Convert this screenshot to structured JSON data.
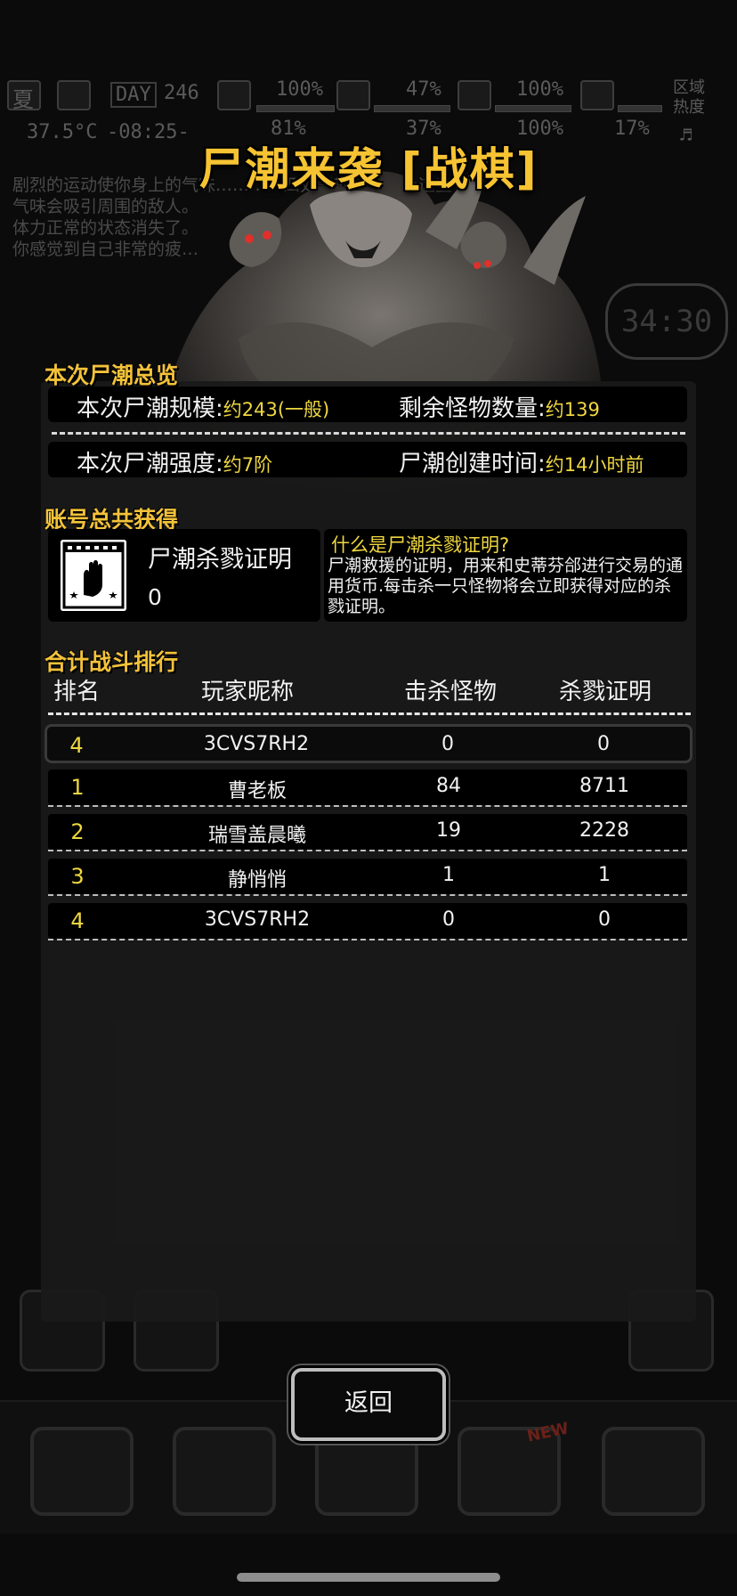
{
  "hud": {
    "season": "夏",
    "day_label": "DAY",
    "day_value": "246",
    "temperature": "37.5°C",
    "clock": "-08:25-",
    "health_pct": "100%",
    "stomach_pct": "47%",
    "stat3_pct": "100%",
    "row2_pct1": "81%",
    "row2_pct2": "37%",
    "row2_pct3": "100%",
    "row2_pct4": "17%",
    "region_heat_label": "区域热度",
    "messages": [
      "剧烈的运动使你身上的气味…………四处飘散，小心！这些",
      "气味会吸引周围的敌人。",
      "体力正常的状态消失了。",
      "你感觉到自己非常的疲…"
    ],
    "timer": "34:30",
    "new_badge": "NEW"
  },
  "title": "尸潮来袭 [战棋]",
  "overview": {
    "heading": "本次尸潮总览",
    "scale_label": "本次尸潮规模:",
    "scale_value": "约243(一般)",
    "remaining_label": "剩余怪物数量:",
    "remaining_value": "约139",
    "intensity_label": "本次尸潮强度:",
    "intensity_value": "约7阶",
    "created_label": "尸潮创建时间:",
    "created_value": "约14小时前"
  },
  "account": {
    "heading": "账号总共获得",
    "cert_name": "尸潮杀戮证明",
    "cert_count": "0",
    "what_title": "什么是尸潮杀戮证明?",
    "what_desc": "尸潮救援的证明，用来和史蒂芬郃进行交易的通用货币.每击杀一只怪物将会立即获得对应的杀戮证明。"
  },
  "ranking": {
    "heading": "合计战斗排行",
    "columns": [
      "排名",
      "玩家昵称",
      "击杀怪物",
      "杀戮证明"
    ],
    "mine": {
      "rank": "4",
      "name": "3CVS7RH2",
      "kills": "0",
      "certs": "0"
    },
    "rows": [
      {
        "rank": "1",
        "name": "曹老板",
        "kills": "84",
        "certs": "8711"
      },
      {
        "rank": "2",
        "name": "瑞雪盖晨曦",
        "kills": "19",
        "certs": "2228"
      },
      {
        "rank": "3",
        "name": "静悄悄",
        "kills": "1",
        "certs": "1"
      },
      {
        "rank": "4",
        "name": "3CVS7RH2",
        "kills": "0",
        "certs": "0"
      }
    ]
  },
  "back_label": "返回",
  "colors": {
    "gold": "#f6c332",
    "value_yellow": "#efd73f",
    "panel": "#1a1a1a"
  }
}
